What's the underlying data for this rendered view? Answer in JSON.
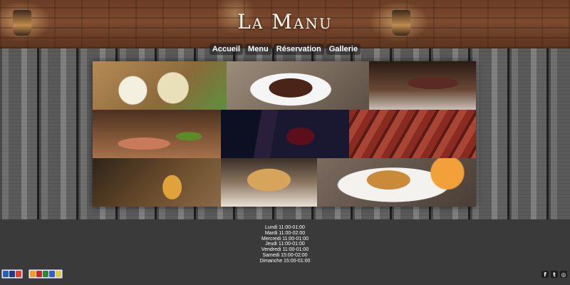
{
  "site": {
    "title": "La Manu"
  },
  "nav": {
    "items": [
      {
        "label": "Accueil"
      },
      {
        "label": "Menu"
      },
      {
        "label": "Réservation"
      },
      {
        "label": "Gallerie"
      }
    ]
  },
  "hours": [
    "Lundi 11:00-01:00",
    "Mardi 11:00-02:00",
    "Mercredi 11:00-01:00",
    "Jeudi 11:00-01:00",
    "Vendredi 11:00-01:00",
    "Samedi 15:00-02:00",
    "Dimanche 15:00-01:00"
  ],
  "social": {
    "facebook": "f",
    "twitter": "t",
    "instagram": "◎"
  },
  "colors": {
    "footer_bg": "#3a3a3a",
    "nav_text": "#ffffff",
    "title_text": "#fffaf0"
  }
}
